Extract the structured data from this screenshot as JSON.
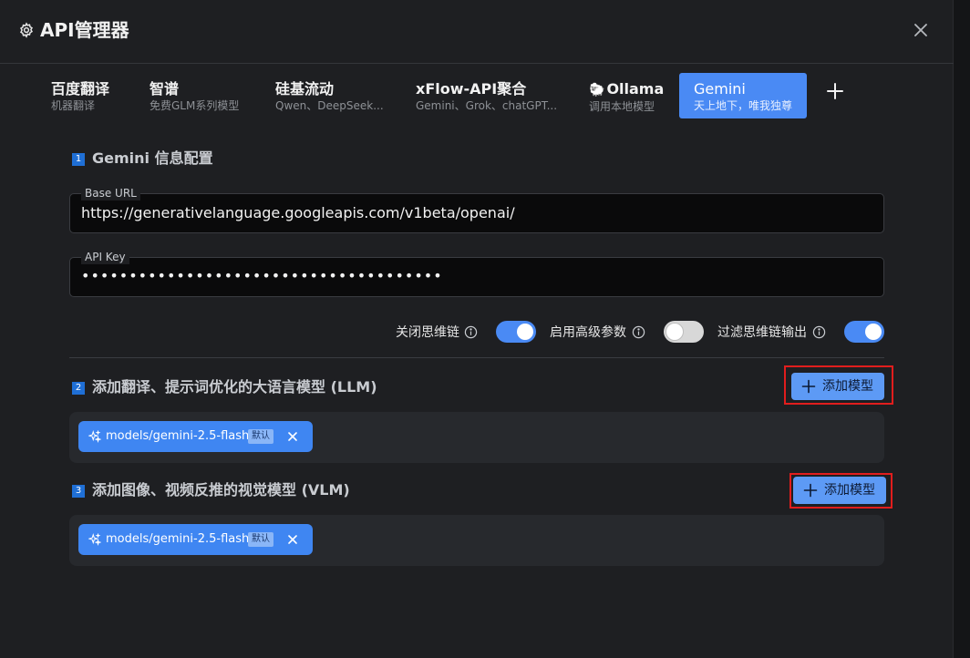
{
  "header": {
    "title": "API管理器",
    "close_icon": "close-icon",
    "settings_icon": "gear-icon"
  },
  "tabs": [
    {
      "name": "百度翻译",
      "desc": "机器翻译"
    },
    {
      "name": "智谱",
      "desc": "免费GLM系列模型"
    },
    {
      "name": "硅基流动",
      "desc": "Qwen、DeepSeek..."
    },
    {
      "name": "xFlow-API聚合",
      "desc": "Gemini、Grok、chatGPT..."
    },
    {
      "name": "Ollama",
      "desc": "调用本地模型",
      "icon": "🐑"
    },
    {
      "name": "Gemini",
      "desc": "天上地下，唯我独尊",
      "active": true
    }
  ],
  "section1": {
    "num": "1",
    "title": "Gemini 信息配置",
    "base_url_label": "Base URL",
    "base_url_value": "https://generativelanguage.googleapis.com/v1beta/openai/",
    "api_key_label": "API Key",
    "api_key_value": "••••••••••••••••••••••••••••••••••••••"
  },
  "toggles": [
    {
      "label": "关闭思维链",
      "state": "on"
    },
    {
      "label": "启用高级参数",
      "state": "off"
    },
    {
      "label": "过滤思维链输出",
      "state": "on"
    }
  ],
  "section2": {
    "num": "2",
    "title": "添加翻译、提示词优化的大语言模型 (LLM)",
    "add_label": "添加模型",
    "models": [
      {
        "name": "models/gemini-2.5-flash",
        "badge": "默认"
      }
    ]
  },
  "section3": {
    "num": "3",
    "title": "添加图像、视频反推的视觉模型 (VLM)",
    "add_label": "添加模型",
    "models": [
      {
        "name": "models/gemini-2.5-flash",
        "badge": "默认"
      }
    ]
  },
  "colors": {
    "accent": "#4a8af4",
    "highlight": "#e11d1d",
    "background": "#1e1f22"
  }
}
